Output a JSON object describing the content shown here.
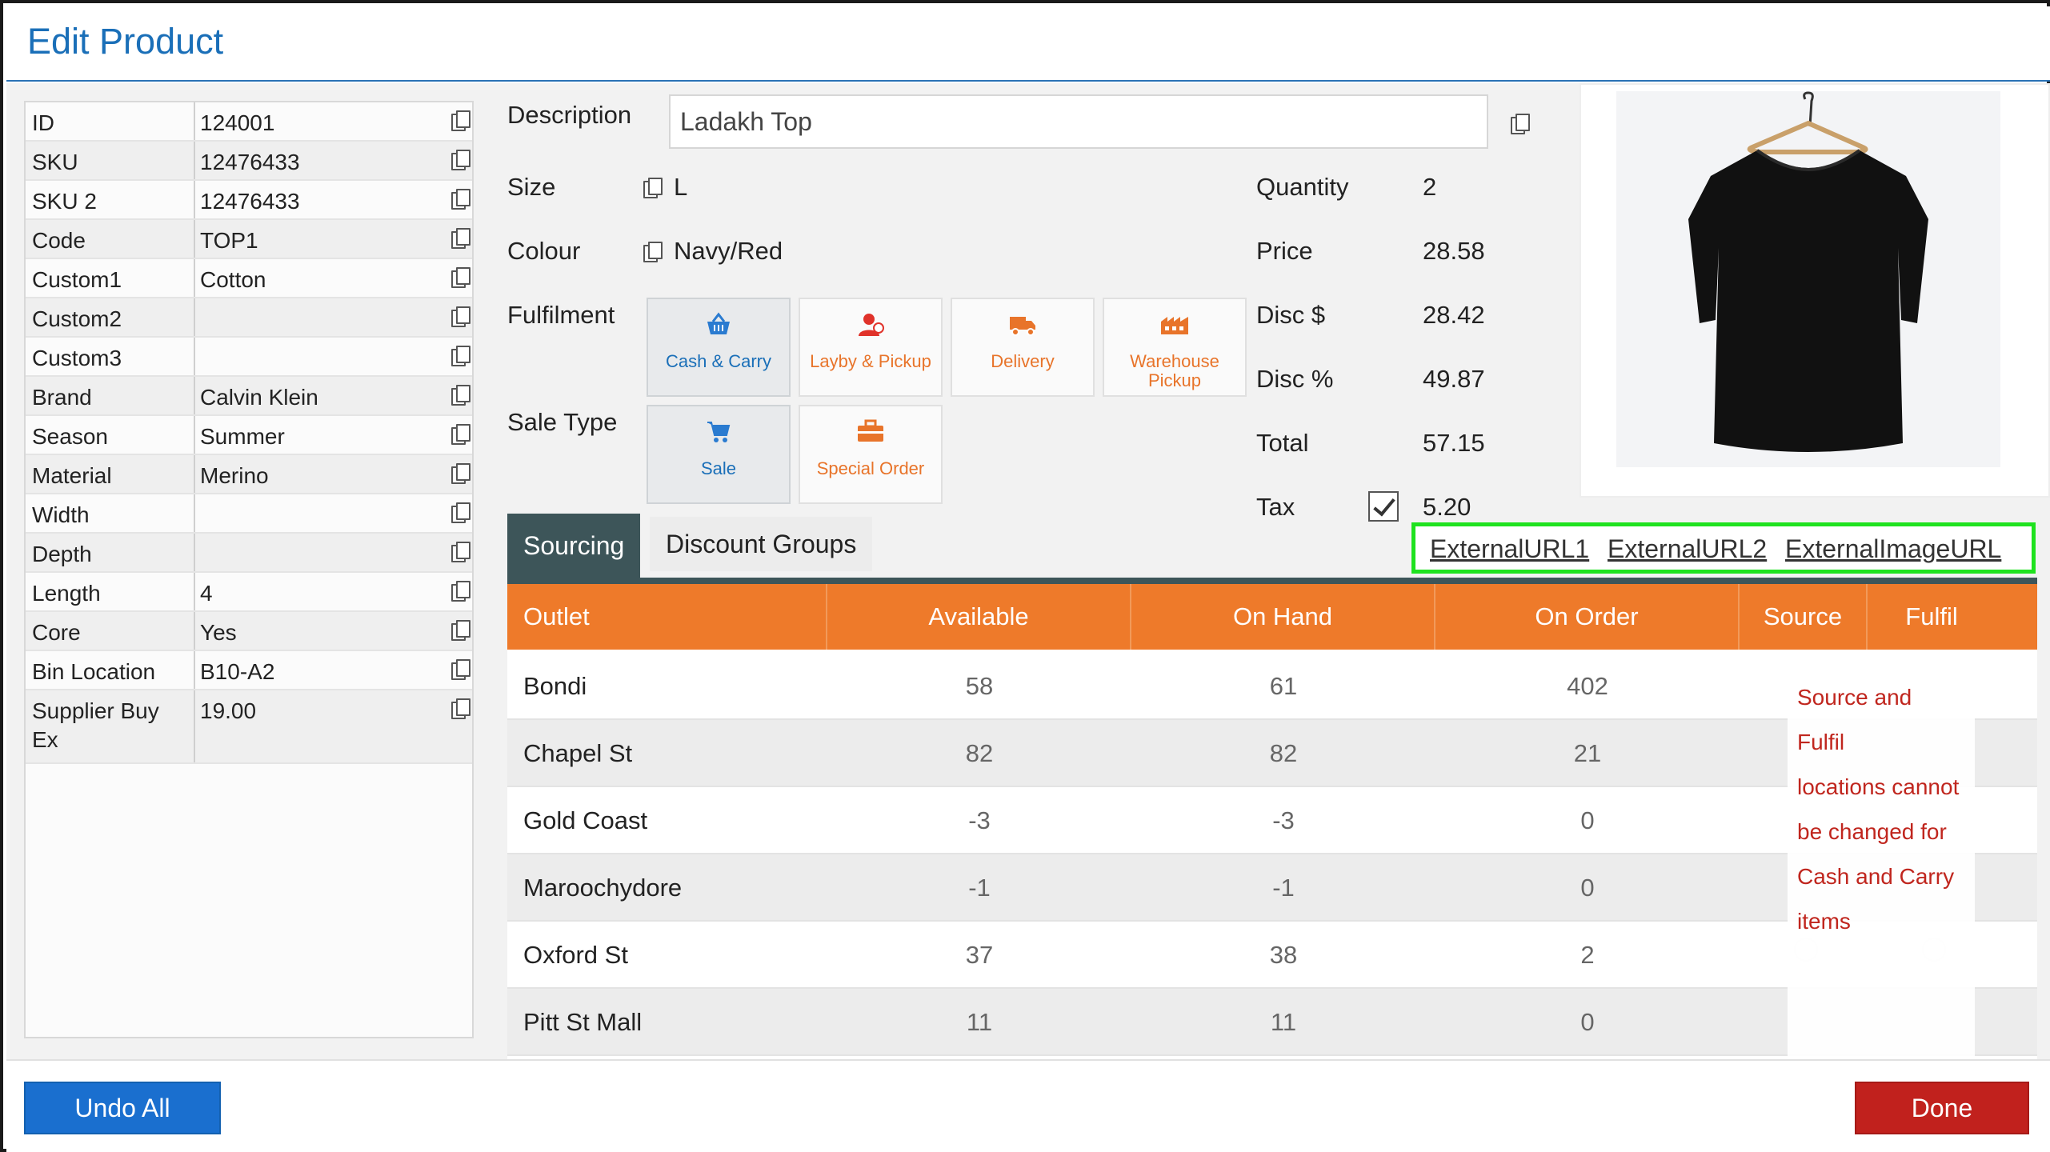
{
  "dialog": {
    "title": "Edit Product"
  },
  "attributes": [
    {
      "label": "ID",
      "value": "124001"
    },
    {
      "label": "SKU",
      "value": "12476433"
    },
    {
      "label": "SKU 2",
      "value": "12476433"
    },
    {
      "label": "Code",
      "value": "TOP1"
    },
    {
      "label": "Custom1",
      "value": "Cotton"
    },
    {
      "label": "Custom2",
      "value": ""
    },
    {
      "label": "Custom3",
      "value": ""
    },
    {
      "label": "Brand",
      "value": "Calvin Klein"
    },
    {
      "label": "Season",
      "value": "Summer"
    },
    {
      "label": "Material",
      "value": "Merino"
    },
    {
      "label": "Width",
      "value": ""
    },
    {
      "label": "Depth",
      "value": ""
    },
    {
      "label": "Length",
      "value": "4"
    },
    {
      "label": "Core",
      "value": "Yes"
    },
    {
      "label": "Bin Location",
      "value": "B10-A2"
    },
    {
      "label": "Supplier Buy Ex",
      "value": "19.00"
    }
  ],
  "details": {
    "description_label": "Description",
    "description_value": "Ladakh Top",
    "size_label": "Size",
    "size_value": "L",
    "colour_label": "Colour",
    "colour_value": "Navy/Red",
    "fulfilment_label": "Fulfilment",
    "sale_type_label": "Sale Type"
  },
  "fulfilment_options": [
    {
      "label": "Cash & Carry",
      "icon": "basket-icon",
      "selected": true
    },
    {
      "label": "Layby & Pickup",
      "icon": "person-icon",
      "selected": false
    },
    {
      "label": "Delivery",
      "icon": "truck-icon",
      "selected": false
    },
    {
      "label": "Warehouse Pickup",
      "icon": "warehouse-icon",
      "selected": false
    }
  ],
  "sale_type_options": [
    {
      "label": "Sale",
      "icon": "cart-icon",
      "selected": true
    },
    {
      "label": "Special Order",
      "icon": "briefcase-icon",
      "selected": false
    }
  ],
  "totals": {
    "quantity_label": "Quantity",
    "quantity_value": "2",
    "price_label": "Price",
    "price_value": "28.58",
    "disc_amount_label": "Disc $",
    "disc_amount_value": "28.42",
    "disc_percent_label": "Disc %",
    "disc_percent_value": "49.87",
    "total_label": "Total",
    "total_value": "57.15",
    "tax_label": "Tax",
    "tax_value": "5.20",
    "tax_checked": true
  },
  "tabs": [
    {
      "label": "Sourcing",
      "active": true
    },
    {
      "label": "Discount Groups",
      "active": false
    }
  ],
  "links": [
    "ExternalURL1",
    "ExternalURL2",
    "ExternalImageURL"
  ],
  "sourcing": {
    "columns": [
      "Outlet",
      "Available",
      "On Hand",
      "On Order",
      "Source",
      "Fulfil"
    ],
    "rows": [
      {
        "outlet": "Bondi",
        "available": "58",
        "on_hand": "61",
        "on_order": "402"
      },
      {
        "outlet": "Chapel St",
        "available": "82",
        "on_hand": "82",
        "on_order": "21"
      },
      {
        "outlet": "Gold Coast",
        "available": "-3",
        "on_hand": "-3",
        "on_order": "0"
      },
      {
        "outlet": "Maroochydore",
        "available": "-1",
        "on_hand": "-1",
        "on_order": "0"
      },
      {
        "outlet": "Oxford St",
        "available": "37",
        "on_hand": "38",
        "on_order": "2"
      },
      {
        "outlet": "Pitt St Mall",
        "available": "11",
        "on_hand": "11",
        "on_order": "0"
      }
    ],
    "tooltip_lines": [
      "Source and Fulfil",
      "locations cannot",
      "be changed for",
      "Cash and Carry",
      "items"
    ]
  },
  "footer": {
    "undo_label": "Undo All",
    "done_label": "Done"
  },
  "colors": {
    "accent_blue": "#1a6fb8",
    "table_header_orange": "#ee7a2a",
    "done_red": "#c1211d",
    "tab_dark": "#3d5559",
    "highlight_green": "#1fe21f"
  }
}
